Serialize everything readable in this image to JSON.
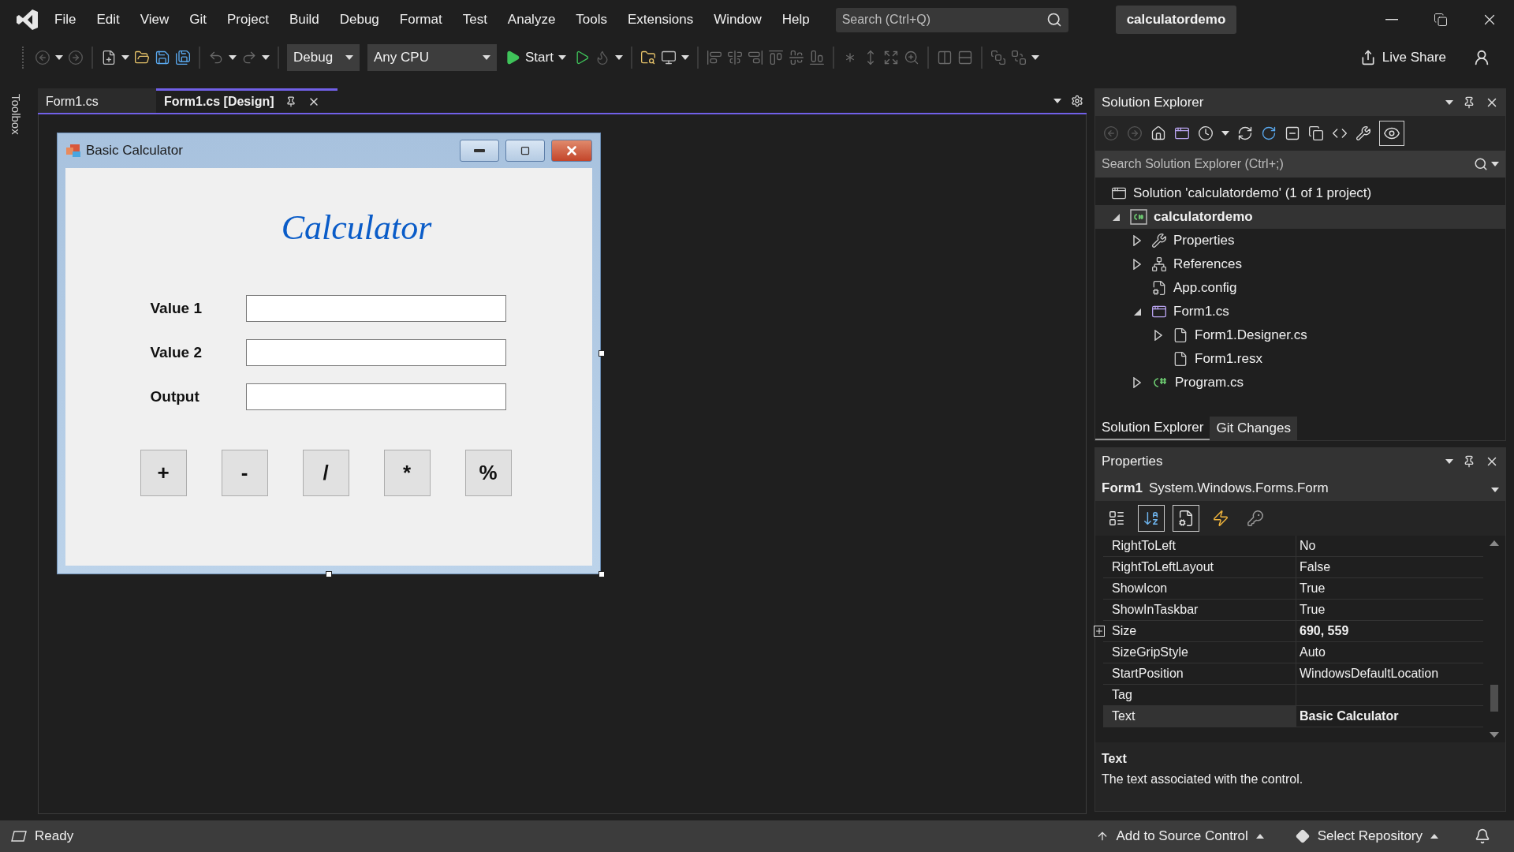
{
  "menu": [
    "File",
    "Edit",
    "View",
    "Git",
    "Project",
    "Build",
    "Debug",
    "Format",
    "Test",
    "Analyze",
    "Tools",
    "Extensions",
    "Window",
    "Help"
  ],
  "search": {
    "placeholder": "Search (Ctrl+Q)"
  },
  "solution_name": "calculatordemo",
  "toolbar": {
    "configuration": "Debug",
    "platform": "Any CPU",
    "start": "Start",
    "live_share": "Live Share"
  },
  "toolbox": {
    "label": "Toolbox"
  },
  "document_tabs": [
    {
      "label": "Form1.cs",
      "selected": false
    },
    {
      "label": "Form1.cs [Design]",
      "selected": true
    }
  ],
  "form": {
    "title": "Basic Calculator",
    "heading": "Calculator",
    "fields": [
      {
        "label": "Value 1"
      },
      {
        "label": "Value 2"
      },
      {
        "label": "Output"
      }
    ],
    "buttons": [
      "+",
      "-",
      "/",
      "*",
      "%"
    ]
  },
  "solution_explorer": {
    "title": "Solution Explorer",
    "search": {
      "placeholder": "Search Solution Explorer (Ctrl+;)"
    },
    "tree": [
      {
        "label": "Solution 'calculatordemo' (1 of 1 project)",
        "kind": "solution",
        "selected": false,
        "children": [
          {
            "label": "calculatordemo",
            "kind": "project",
            "expanded": true,
            "selected": true,
            "children": [
              {
                "label": "Properties",
                "kind": "properties",
                "expanded": false,
                "selected": false
              },
              {
                "label": "References",
                "kind": "references",
                "expanded": false,
                "selected": false
              },
              {
                "label": "App.config",
                "kind": "config",
                "selected": false
              },
              {
                "label": "Form1.cs",
                "kind": "form",
                "expanded": true,
                "selected": false,
                "children": [
                  {
                    "label": "Form1.Designer.cs",
                    "kind": "file",
                    "expanded": false,
                    "selected": false
                  },
                  {
                    "label": "Form1.resx",
                    "kind": "file",
                    "selected": false
                  }
                ]
              },
              {
                "label": "Program.cs",
                "kind": "csharp",
                "expanded": false,
                "selected": false
              }
            ]
          }
        ]
      }
    ],
    "tabs": [
      {
        "label": "Solution Explorer",
        "selected": true
      },
      {
        "label": "Git Changes",
        "selected": false
      }
    ]
  },
  "properties": {
    "title": "Properties",
    "object": "Form1",
    "type": "System.Windows.Forms.Form",
    "view_buttons": [
      {
        "kind": "categorized",
        "selected": false
      },
      {
        "kind": "alphabetical",
        "selected": true
      },
      {
        "kind": "property-pages",
        "selected": true
      },
      {
        "kind": "events",
        "selected": false
      },
      {
        "kind": "key",
        "selected": false
      }
    ],
    "rows": [
      {
        "name": "RightToLeft",
        "value": "No",
        "bold": false,
        "expandable": false,
        "selected": false
      },
      {
        "name": "RightToLeftLayout",
        "value": "False",
        "bold": false,
        "expandable": false,
        "selected": false
      },
      {
        "name": "ShowIcon",
        "value": "True",
        "bold": false,
        "expandable": false,
        "selected": false
      },
      {
        "name": "ShowInTaskbar",
        "value": "True",
        "bold": false,
        "expandable": false,
        "selected": false
      },
      {
        "name": "Size",
        "value": "690, 559",
        "bold": true,
        "expandable": true,
        "selected": false
      },
      {
        "name": "SizeGripStyle",
        "value": "Auto",
        "bold": false,
        "expandable": false,
        "selected": false
      },
      {
        "name": "StartPosition",
        "value": "WindowsDefaultLocation",
        "bold": false,
        "expandable": false,
        "selected": false
      },
      {
        "name": "Tag",
        "expandable": false,
        "selected": false
      },
      {
        "name": "Text",
        "value": "Basic Calculator",
        "bold": true,
        "expandable": false,
        "selected": true
      }
    ],
    "description": {
      "title": "Text",
      "text": "The text associated with the control."
    }
  },
  "status_bar": {
    "status": "Ready",
    "source_control": "Add to Source Control",
    "repository": "Select Repository"
  }
}
